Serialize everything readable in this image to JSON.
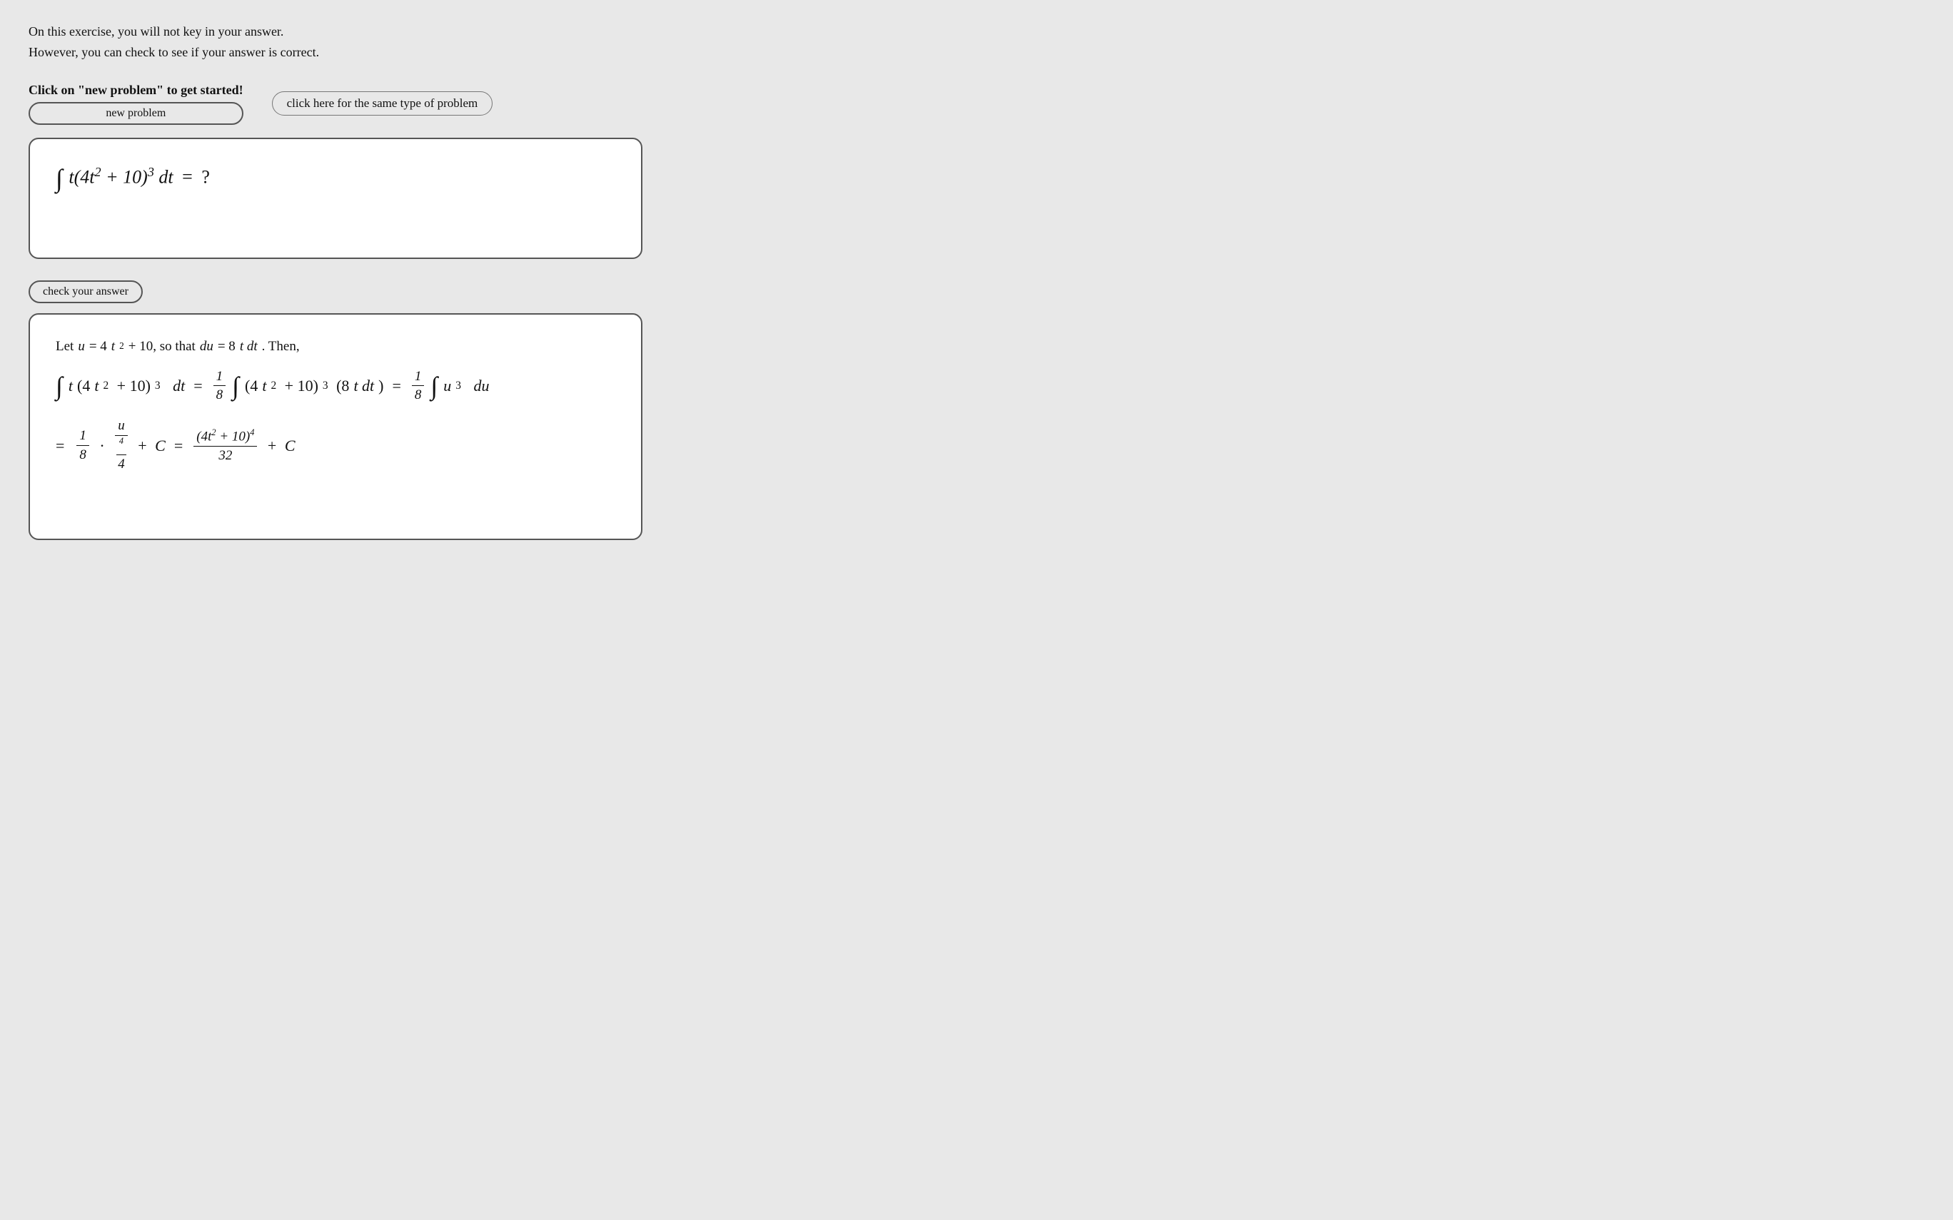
{
  "intro": {
    "line1": "On this exercise, you will not key in your answer.",
    "line2": "However, you can check to see if your answer is correct."
  },
  "new_problem": {
    "prompt": "Click on \"new problem\" to get started!",
    "button_label": "new problem"
  },
  "same_type_button": "click here for the same type of problem",
  "check_answer_button": "check your answer",
  "solution": {
    "let_statement": "Let u = 4t² + 10, so that du = 8t dt. Then,"
  }
}
